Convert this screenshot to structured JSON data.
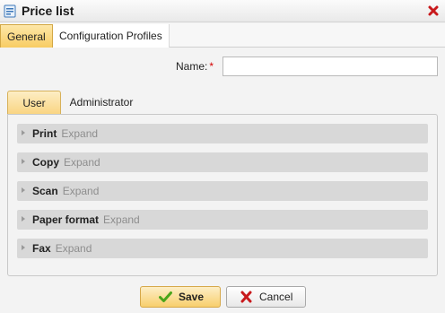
{
  "window": {
    "title": "Price list",
    "icon": "price-list-icon",
    "close_icon": "close-icon"
  },
  "top_tabs": [
    {
      "label": "General",
      "active": true
    },
    {
      "label": "Configuration Profiles",
      "active": false
    }
  ],
  "form": {
    "name_label": "Name:",
    "required_mark": "*",
    "name_value": ""
  },
  "inner_tabs": [
    {
      "label": "User",
      "active": true
    },
    {
      "label": "Administrator",
      "active": false
    }
  ],
  "sections": [
    {
      "name": "Print",
      "action": "Expand"
    },
    {
      "name": "Copy",
      "action": "Expand"
    },
    {
      "name": "Scan",
      "action": "Expand"
    },
    {
      "name": "Paper format",
      "action": "Expand"
    },
    {
      "name": "Fax",
      "action": "Expand"
    }
  ],
  "buttons": {
    "save_label": "Save",
    "save_icon": "checkmark-icon",
    "cancel_label": "Cancel",
    "cancel_icon": "red-x-icon"
  },
  "colors": {
    "accent": "#f8cc63",
    "required": "#d40000",
    "save_check": "#4aa51a",
    "cancel_x": "#c8191c"
  }
}
